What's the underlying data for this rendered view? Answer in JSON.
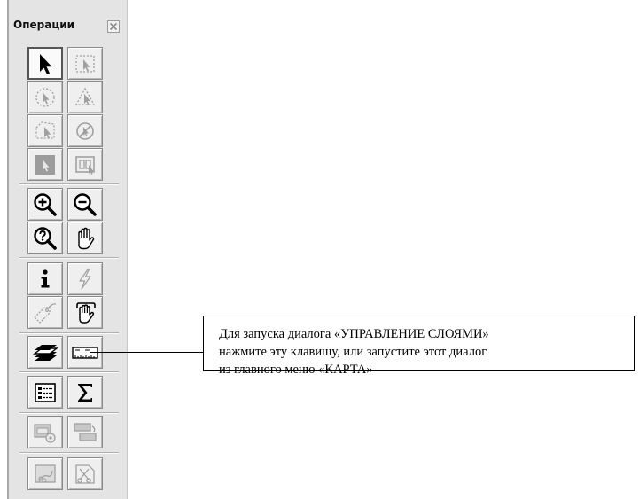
{
  "palette": {
    "title": "Операции",
    "close_icon": "close-icon",
    "tools": [
      {
        "name": "select-arrow",
        "icon": "arrow-icon",
        "state": "active"
      },
      {
        "name": "select-rectangle",
        "icon": "marquee-select-icon",
        "state": "disabled"
      },
      {
        "name": "select-radius",
        "icon": "radius-select-icon",
        "state": "disabled"
      },
      {
        "name": "select-polygon",
        "icon": "polygon-select-icon",
        "state": "disabled"
      },
      {
        "name": "select-boundary",
        "icon": "boundary-select-icon",
        "state": "disabled"
      },
      {
        "name": "unselect-all",
        "icon": "unselect-icon",
        "state": "disabled"
      },
      {
        "name": "select-in-layer",
        "icon": "layer-select-icon",
        "state": "disabled"
      },
      {
        "name": "graph-select",
        "icon": "graph-select-icon",
        "state": "disabled"
      },
      {
        "name": "zoom-in",
        "icon": "zoom-in-icon",
        "state": "enabled"
      },
      {
        "name": "zoom-out",
        "icon": "zoom-out-icon",
        "state": "enabled"
      },
      {
        "name": "change-view",
        "icon": "zoom-question-icon",
        "state": "enabled"
      },
      {
        "name": "pan",
        "icon": "hand-icon",
        "state": "enabled"
      },
      {
        "name": "info",
        "icon": "info-icon",
        "state": "enabled"
      },
      {
        "name": "hotlink",
        "icon": "lightning-icon",
        "state": "disabled"
      },
      {
        "name": "label",
        "icon": "label-tag-icon",
        "state": "disabled"
      },
      {
        "name": "drag-window",
        "icon": "drag-hand-icon",
        "state": "enabled"
      },
      {
        "name": "layer-control",
        "icon": "layers-icon",
        "state": "enabled"
      },
      {
        "name": "ruler",
        "icon": "ruler-icon",
        "state": "enabled"
      },
      {
        "name": "legend",
        "icon": "legend-icon",
        "state": "enabled"
      },
      {
        "name": "statistics",
        "icon": "sigma-icon",
        "state": "enabled"
      },
      {
        "name": "clip-region",
        "icon": "clip-region-icon",
        "state": "disabled"
      },
      {
        "name": "clip-toggle",
        "icon": "clip-toggle-icon",
        "state": "disabled"
      },
      {
        "name": "set-target",
        "icon": "set-target-icon",
        "state": "disabled"
      },
      {
        "name": "cut-tool",
        "icon": "scissors-icon",
        "state": "disabled"
      }
    ]
  },
  "callout": {
    "line1": "Для запуска диалога «УПРАВЛЕНИЕ СЛОЯМИ»",
    "line2": "нажмите эту клавишу, или запустите этот диалог",
    "line3": "из главного меню «КАРТА»"
  },
  "colors": {
    "panel_bg": "#e4e4e4",
    "icon_enabled": "#000000",
    "icon_disabled": "#a0a0a0"
  }
}
